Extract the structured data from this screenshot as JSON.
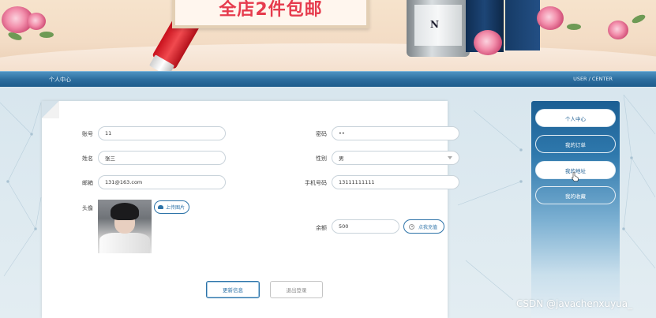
{
  "banner": {
    "promo_text": "全店2件包邮",
    "product_logo": "N"
  },
  "nav": {
    "left_label": "个人中心",
    "right_label": "USER / CENTER"
  },
  "form": {
    "account": {
      "label": "账号",
      "value": "11"
    },
    "password": {
      "label": "密码",
      "value": "••"
    },
    "name": {
      "label": "姓名",
      "value": "张三"
    },
    "gender": {
      "label": "性别",
      "value": "男"
    },
    "email": {
      "label": "邮箱",
      "value": "131@163.com"
    },
    "phone": {
      "label": "手机号码",
      "value": "13111111111"
    },
    "avatar": {
      "label": "头像",
      "upload_label": "上传图片"
    },
    "balance": {
      "label": "余额",
      "value": "500",
      "recharge_label": "点我充值"
    },
    "update_button": "更新信息",
    "logout_button": "退出登录"
  },
  "sidebar": {
    "items": [
      {
        "label": "个人中心",
        "state": "active"
      },
      {
        "label": "我的订单",
        "state": "normal"
      },
      {
        "label": "我的地址",
        "state": "hover"
      },
      {
        "label": "我的收藏",
        "state": "normal"
      }
    ]
  },
  "watermark": "CSDN @javachenxuyua_",
  "colors": {
    "nav": "#2d6e9f",
    "accent": "#2d73a8",
    "promo": "#e63b4d"
  }
}
